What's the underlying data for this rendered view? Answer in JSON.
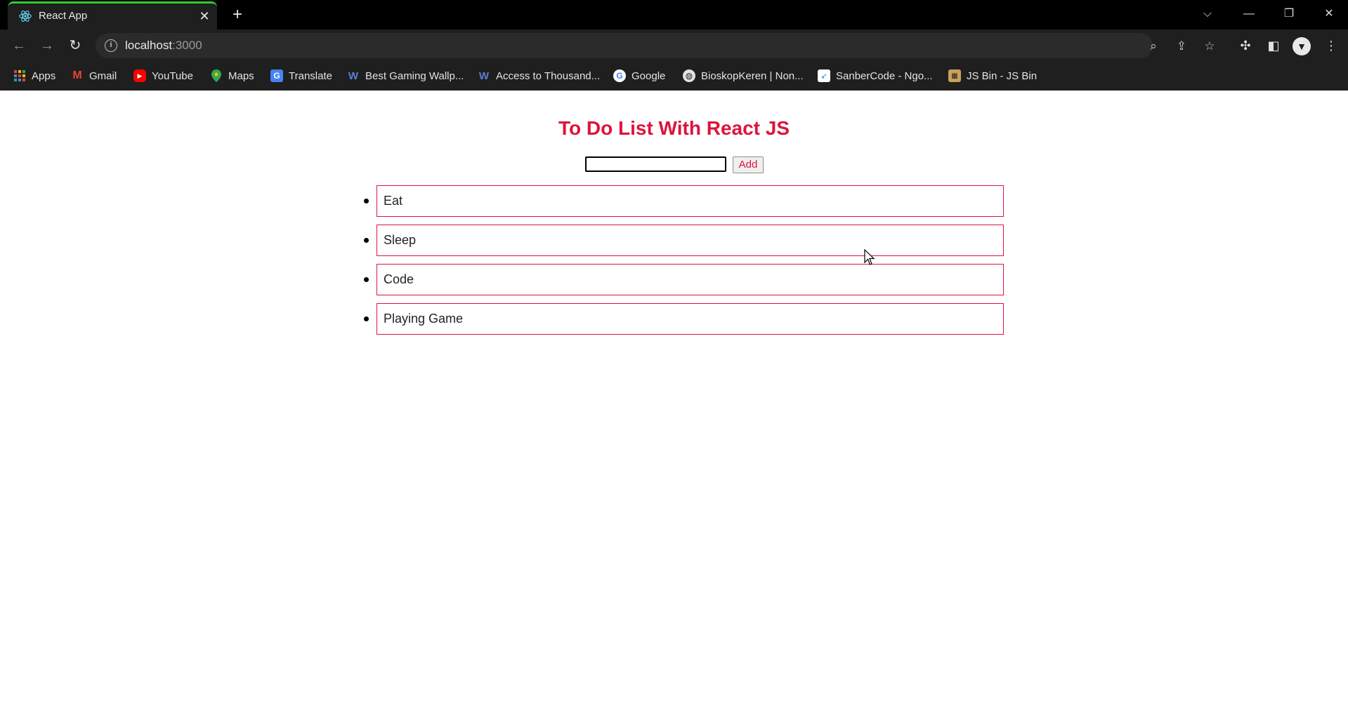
{
  "browser": {
    "tab_title": "React App",
    "tab_icon": "react-logo-icon",
    "url_host": "localhost",
    "url_port": ":3000",
    "bookmarks": [
      {
        "label": "Apps",
        "icon": "apps-grid-icon"
      },
      {
        "label": "Gmail",
        "icon": "gmail-icon"
      },
      {
        "label": "YouTube",
        "icon": "youtube-icon"
      },
      {
        "label": "Maps",
        "icon": "maps-pin-icon"
      },
      {
        "label": "Translate",
        "icon": "translate-icon"
      },
      {
        "label": "Best Gaming Wallp...",
        "icon": "wallpaper-site-icon"
      },
      {
        "label": "Access to Thousand...",
        "icon": "wallpaper-site-icon"
      },
      {
        "label": "Google",
        "icon": "google-icon"
      },
      {
        "label": "BioskopKeren | Non...",
        "icon": "globe-icon"
      },
      {
        "label": "SanberCode - Ngo...",
        "icon": "sanbercode-icon"
      },
      {
        "label": "JS Bin - JS Bin",
        "icon": "jsbin-icon"
      }
    ],
    "colors": {
      "tab_accent": "#33cc33",
      "chrome_bg": "#1f1f1f"
    }
  },
  "app": {
    "title": "To Do List With React JS",
    "input_value": "",
    "add_label": "Add",
    "todos": [
      "Eat",
      "Sleep",
      "Code",
      "Playing Game"
    ],
    "colors": {
      "accent": "#dc143c"
    }
  }
}
